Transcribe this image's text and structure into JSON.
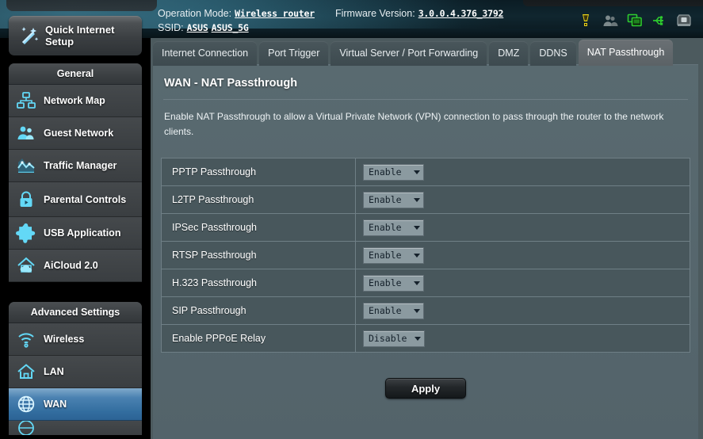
{
  "header": {
    "operation_mode_label": "Operation Mode:",
    "operation_mode_value": "Wireless router",
    "firmware_label": "Firmware Version:",
    "firmware_value": "3.0.0.4.376_3792",
    "ssid_label": "SSID:",
    "ssid_value_1": "ASUS",
    "ssid_value_2": "ASUS_5G",
    "icons": [
      {
        "name": "alert-icon",
        "color": "#e8d21a"
      },
      {
        "name": "clients-icon",
        "color": "#7d8a8d"
      },
      {
        "name": "monitor-icon",
        "color": "#2ecc2e"
      },
      {
        "name": "usb-icon",
        "color": "#2ecc2e"
      },
      {
        "name": "printer-icon",
        "color": "#7d8a8d"
      }
    ]
  },
  "sidebar": {
    "quick_setup_label": "Quick Internet Setup",
    "general_title": "General",
    "advanced_title": "Advanced Settings",
    "general_items": [
      {
        "label": "Network Map",
        "icon": "network-map-icon"
      },
      {
        "label": "Guest Network",
        "icon": "guest-network-icon"
      },
      {
        "label": "Traffic Manager",
        "icon": "traffic-manager-icon"
      },
      {
        "label": "Parental Controls",
        "icon": "parental-controls-icon"
      },
      {
        "label": "USB Application",
        "icon": "usb-application-icon"
      },
      {
        "label": "AiCloud 2.0",
        "icon": "aicloud-icon"
      }
    ],
    "advanced_items": [
      {
        "label": "Wireless",
        "icon": "wireless-icon",
        "active": false
      },
      {
        "label": "LAN",
        "icon": "lan-icon",
        "active": false
      },
      {
        "label": "WAN",
        "icon": "wan-icon",
        "active": true
      }
    ],
    "accent_active": "#326d9f"
  },
  "tabs": [
    {
      "label": "Internet Connection",
      "active": false
    },
    {
      "label": "Port Trigger",
      "active": false
    },
    {
      "label": "Virtual Server / Port Forwarding",
      "active": false
    },
    {
      "label": "DMZ",
      "active": false
    },
    {
      "label": "DDNS",
      "active": false
    },
    {
      "label": "NAT Passthrough",
      "active": true
    }
  ],
  "main": {
    "title": "WAN - NAT Passthrough",
    "description": "Enable NAT Passthrough to allow a Virtual Private Network (VPN) connection to pass through the router to the network clients.",
    "rows": [
      {
        "label": "PPTP Passthrough",
        "value": "Enable"
      },
      {
        "label": "L2TP Passthrough",
        "value": "Enable"
      },
      {
        "label": "IPSec Passthrough",
        "value": "Enable"
      },
      {
        "label": "RTSP Passthrough",
        "value": "Enable"
      },
      {
        "label": "H.323 Passthrough",
        "value": "Enable"
      },
      {
        "label": "SIP Passthrough",
        "value": "Enable"
      },
      {
        "label": "Enable PPPoE Relay",
        "value": "Disable"
      }
    ],
    "select_options": [
      "Enable",
      "Disable"
    ],
    "apply_label": "Apply"
  }
}
